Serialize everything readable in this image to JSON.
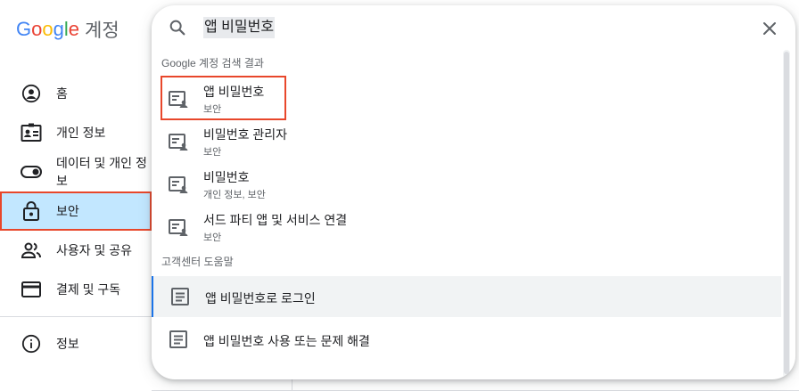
{
  "brand": {
    "logo_letters": [
      "G",
      "o",
      "o",
      "g",
      "l",
      "e"
    ],
    "logo_colors": [
      "#4285f4",
      "#ea4335",
      "#fbbc05",
      "#4285f4",
      "#34a853",
      "#ea4335"
    ],
    "product": "계정"
  },
  "nav": {
    "items": [
      {
        "label": "홈",
        "icon": "home-icon"
      },
      {
        "label": "개인 정보",
        "icon": "id-card-icon"
      },
      {
        "label": "데이터 및 개인 정보",
        "icon": "toggle-icon"
      },
      {
        "label": "보안",
        "icon": "lock-icon"
      },
      {
        "label": "사용자 및 공유",
        "icon": "people-icon"
      },
      {
        "label": "결제 및 구독",
        "icon": "credit-card-icon"
      }
    ],
    "info_label": "정보",
    "active_color": "#c2e7ff",
    "highlight_color": "#e8472b"
  },
  "search": {
    "query": "앱 비밀번호",
    "account_results_label": "Google 계정 검색 결과",
    "account_results": [
      {
        "title": "앱 비밀번호",
        "subtitle": "보안"
      },
      {
        "title": "비밀번호 관리자",
        "subtitle": "보안"
      },
      {
        "title": "비밀번호",
        "subtitle": "개인 정보, 보안"
      },
      {
        "title": "서드 파티 앱 및 서비스 연결",
        "subtitle": "보안"
      }
    ],
    "help_label": "고객센터 도움말",
    "help_results": [
      {
        "title": "앱 비밀번호로 로그인"
      },
      {
        "title": "앱 비밀번호 사용 또는 문제 해결"
      }
    ]
  }
}
